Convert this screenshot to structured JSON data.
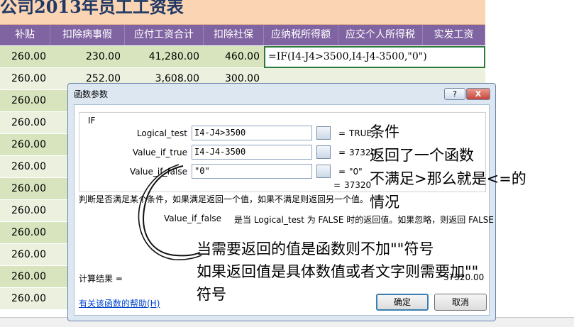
{
  "sheet": {
    "title": "公司2013年员工工资表",
    "headers": [
      "补贴",
      "扣除病事假",
      "应付工资合计",
      "扣除社保",
      "应纳税所得额",
      "应交个人所得税",
      "实发工资"
    ],
    "rows": [
      [
        "260.00",
        "230.00",
        "41,280.00",
        "460.00"
      ],
      [
        "260.00",
        "252.00",
        "3,608.00",
        "300.00"
      ],
      [
        "260.00"
      ],
      [
        "260.00"
      ],
      [
        "260.00"
      ],
      [
        "260.00"
      ],
      [
        "260.00"
      ],
      [
        "260.00"
      ],
      [
        "260.00"
      ],
      [
        "260.00"
      ],
      [
        "260.00"
      ],
      [
        "260.00"
      ]
    ],
    "formula": "=IF(I4-J4>3500,I4-J4-3500,\"0\")"
  },
  "dialog": {
    "title": "函数参数",
    "help_btn": "?",
    "close_btn": "X",
    "func_name": "IF",
    "args": [
      {
        "label": "Logical_test",
        "value": "I4-J4>3500",
        "result": "TRUE"
      },
      {
        "label": "Value_if_true",
        "value": "I4-J4-3500",
        "result": "37320"
      },
      {
        "label": "Value_if_false",
        "value": "\"0\"",
        "result": "\"0\""
      }
    ],
    "total_result": "37320",
    "description": "判断是否满足某个条件，如果满足返回一个值，如果不满足则返回另一个值。",
    "arg_desc_name": "Value_if_false",
    "arg_desc_text": "是当 Logical_test 为 FALSE 时的返回值。如果忽略，则返回 FALSE",
    "calc_label": "计算结果 =",
    "calc_value": "37320.00",
    "help_link": "有关该函数的帮助(H)",
    "ok": "确定",
    "cancel": "取消"
  },
  "annotations": {
    "n1": "条件",
    "n2": "返回了一个函数",
    "n3": "不满足>那么就是<=的",
    "n4": "情况",
    "n5": "当需要返回的值是函数则不加\"\"符号",
    "n6": "如果返回值是具体数值或者文字则需要加\"\"",
    "n7": "符号"
  }
}
